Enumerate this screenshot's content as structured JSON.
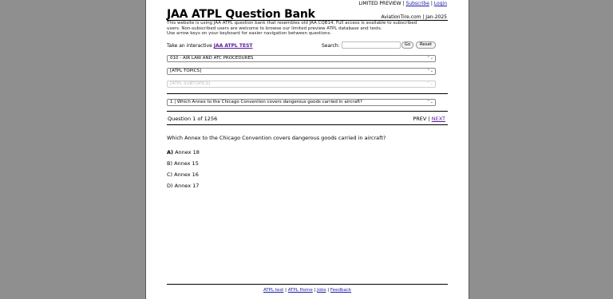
{
  "topbar": {
    "preview": "LIMITED PREVIEW",
    "sep1": "|",
    "subscribe": "Subscribe",
    "sep2": "|",
    "login": "Login"
  },
  "header": {
    "title": "JAA ATPL Question Bank",
    "site_date": "AviationTire.com | Jan-2025"
  },
  "intro": {
    "line1": "This website is using JAA ATPL question bank that resembles old JAA CQB14. Full access is available to subscribed",
    "line2": "users. Non-subscribed users are welcome to browse our limited preview ATPL database and tests.",
    "line3": "Use arrow keys on your keyboard for easier navigation between questions."
  },
  "test_link": {
    "prefix": "Take an interactive",
    "link": "JAA ATPL TEST"
  },
  "search": {
    "label": "Search:",
    "value": "",
    "go_label": "Go",
    "reset_label": "Reset"
  },
  "selects": {
    "subject": "010 - AIR LAW AND ATC PROCEDURES",
    "topic": "[ATPL TOPICS]",
    "subtopic": "[ATPL SUBTOPICS]",
    "question": "1 | Which Annex to the Chicago Convention covers dangerous goods carried in aircraft?",
    "arrows": "⌃⌄"
  },
  "question": {
    "counter": "Question 1 of 1256",
    "prev": "PREV",
    "sep": "|",
    "next": "NEXT",
    "text": "Which Annex to the Chicago Convention covers dangerous goods carried in aircraft?",
    "answers": [
      {
        "letter": "A)",
        "text": "Annex 18"
      },
      {
        "letter": "B)",
        "text": "Annex 15"
      },
      {
        "letter": "C)",
        "text": "Annex 16"
      },
      {
        "letter": "D)",
        "text": "Annex 17"
      }
    ]
  },
  "footer": {
    "link1": "ATPL test",
    "sep1": "|",
    "link2": "ATPL Home",
    "sep2": "|",
    "link3": "Jobs",
    "sep3": "|",
    "link4": "Feedback"
  }
}
